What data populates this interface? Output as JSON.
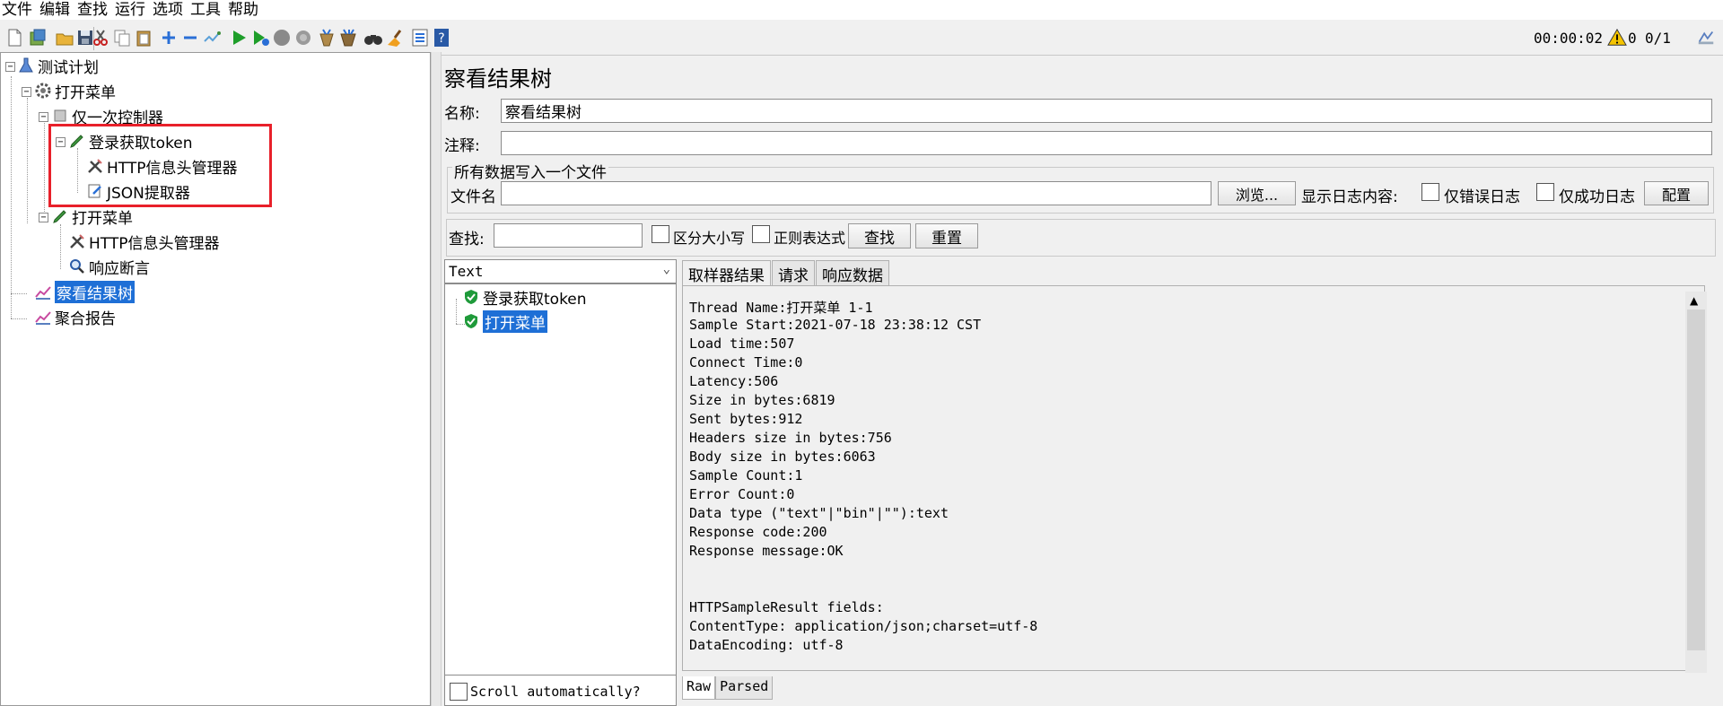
{
  "menu": [
    "文件",
    "编辑",
    "查找",
    "运行",
    "选项",
    "工具",
    "帮助"
  ],
  "toolbar": {
    "timer": "00:00:02",
    "error_count": "0",
    "thread_count": "0/1",
    "colors": {
      "start": "#1e9e2a",
      "stop": "#8a8a8a",
      "add": "#2a6fd6",
      "warning": "#f5c400"
    }
  },
  "tree": {
    "items": [
      {
        "label": "测试计划",
        "icon": "flask-icon"
      },
      {
        "label": "打开菜单",
        "icon": "gear-icon"
      },
      {
        "label": "仅一次控制器",
        "icon": "controller-icon"
      },
      {
        "label": "登录获取token",
        "icon": "pencil-sampler-icon"
      },
      {
        "label": "HTTP信息头管理器",
        "icon": "tools-icon"
      },
      {
        "label": "JSON提取器",
        "icon": "extractor-icon"
      },
      {
        "label": "打开菜单",
        "icon": "pencil-sampler-icon"
      },
      {
        "label": "HTTP信息头管理器",
        "icon": "tools-icon"
      },
      {
        "label": "响应断言",
        "icon": "magnifier-icon"
      },
      {
        "label": "察看结果树",
        "icon": "chart-icon",
        "selected": true
      },
      {
        "label": "聚合报告",
        "icon": "chart-icon"
      }
    ],
    "highlight_color": "#e8202a"
  },
  "listener": {
    "title": "察看结果树",
    "name_label": "名称:",
    "name_value": "察看结果树",
    "comment_label": "注释:",
    "comment_value": "",
    "file_group_title": "所有数据写入一个文件",
    "filename_label": "文件名",
    "filename_value": "",
    "browse_button": "浏览...",
    "log_display_label": "显示日志内容:",
    "errors_only_label": "仅错误日志",
    "success_only_label": "仅成功日志",
    "configure_button": "配置"
  },
  "search": {
    "label": "查找:",
    "value": "",
    "case_sensitive_label": "区分大小写",
    "regex_label": "正则表达式",
    "find_button": "查找",
    "reset_button": "重置"
  },
  "results": {
    "render_mode": "Text",
    "samples": [
      {
        "label": "登录获取token",
        "status": "success"
      },
      {
        "label": "打开菜单",
        "status": "success",
        "selected": true
      }
    ],
    "scroll_auto_label": "Scroll automatically?",
    "tabs": [
      "取样器结果",
      "请求",
      "响应数据"
    ],
    "bottom_tabs": [
      "Raw",
      "Parsed"
    ],
    "detail_lines": [
      "Thread Name:打开菜单 1-1",
      "Sample Start:2021-07-18 23:38:12 CST",
      "Load time:507",
      "Connect Time:0",
      "Latency:506",
      "Size in bytes:6819",
      "Sent bytes:912",
      "Headers size in bytes:756",
      "Body size in bytes:6063",
      "Sample Count:1",
      "Error Count:0",
      "Data type (\"text\"|\"bin\"|\"\"):text",
      "Response code:200",
      "Response message:OK",
      "",
      "",
      "HTTPSampleResult fields:",
      "ContentType: application/json;charset=utf-8",
      "DataEncoding: utf-8"
    ]
  }
}
